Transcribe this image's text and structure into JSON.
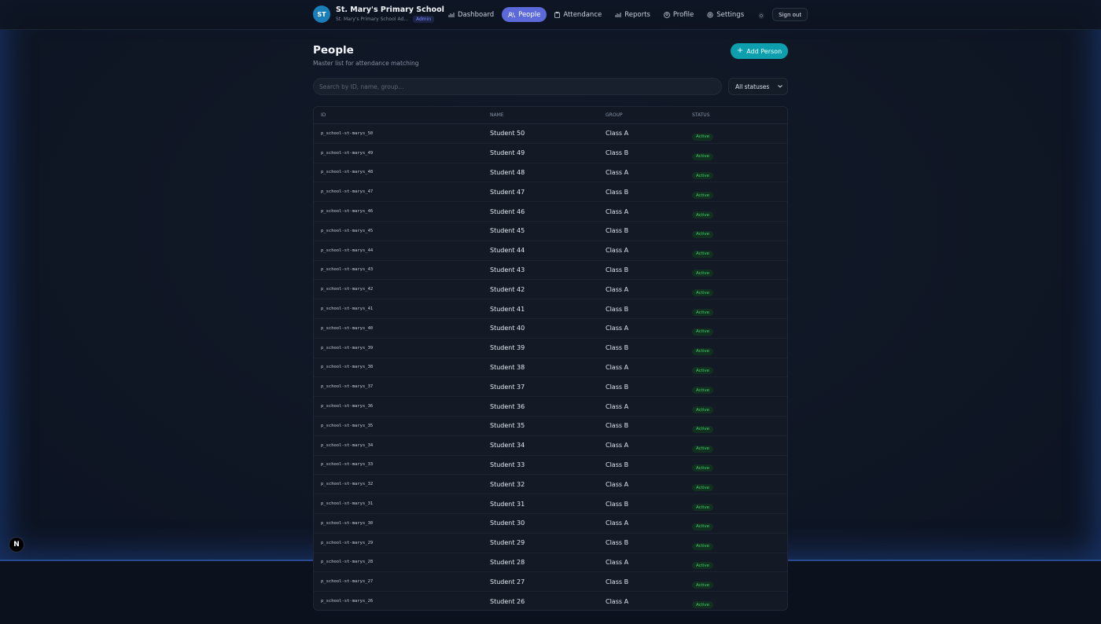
{
  "brand": {
    "initials": "ST",
    "name": "St. Mary's Primary School",
    "subtitle": "St. Mary's Primary School Ad...",
    "role_badge": "Admin"
  },
  "nav": {
    "items": [
      {
        "label": "Dashboard",
        "icon": "bar-chart-icon",
        "active": false
      },
      {
        "label": "People",
        "icon": "users-icon",
        "active": true
      },
      {
        "label": "Attendance",
        "icon": "clipboard-icon",
        "active": false
      },
      {
        "label": "Reports",
        "icon": "bar-chart-icon",
        "active": false
      },
      {
        "label": "Profile",
        "icon": "user-circle-icon",
        "active": false
      },
      {
        "label": "Settings",
        "icon": "gear-icon",
        "active": false
      }
    ],
    "theme_icon": "sun-icon",
    "signout_label": "Sign out"
  },
  "page": {
    "title": "People",
    "subtitle": "Master list for attendance matching",
    "add_button_label": "Add Person"
  },
  "filters": {
    "search_placeholder": "Search by ID, name, group...",
    "search_value": "",
    "status_selected": "All statuses"
  },
  "table": {
    "columns": [
      "ID",
      "NAME",
      "GROUP",
      "STATUS"
    ],
    "rows": [
      {
        "id": "p_school-st-marys_50",
        "name": "Student 50",
        "group": "Class A",
        "status": "Active"
      },
      {
        "id": "p_school-st-marys_49",
        "name": "Student 49",
        "group": "Class B",
        "status": "Active"
      },
      {
        "id": "p_school-st-marys_48",
        "name": "Student 48",
        "group": "Class A",
        "status": "Active"
      },
      {
        "id": "p_school-st-marys_47",
        "name": "Student 47",
        "group": "Class B",
        "status": "Active"
      },
      {
        "id": "p_school-st-marys_46",
        "name": "Student 46",
        "group": "Class A",
        "status": "Active"
      },
      {
        "id": "p_school-st-marys_45",
        "name": "Student 45",
        "group": "Class B",
        "status": "Active"
      },
      {
        "id": "p_school-st-marys_44",
        "name": "Student 44",
        "group": "Class A",
        "status": "Active"
      },
      {
        "id": "p_school-st-marys_43",
        "name": "Student 43",
        "group": "Class B",
        "status": "Active"
      },
      {
        "id": "p_school-st-marys_42",
        "name": "Student 42",
        "group": "Class A",
        "status": "Active"
      },
      {
        "id": "p_school-st-marys_41",
        "name": "Student 41",
        "group": "Class B",
        "status": "Active"
      },
      {
        "id": "p_school-st-marys_40",
        "name": "Student 40",
        "group": "Class A",
        "status": "Active"
      },
      {
        "id": "p_school-st-marys_39",
        "name": "Student 39",
        "group": "Class B",
        "status": "Active"
      },
      {
        "id": "p_school-st-marys_38",
        "name": "Student 38",
        "group": "Class A",
        "status": "Active"
      },
      {
        "id": "p_school-st-marys_37",
        "name": "Student 37",
        "group": "Class B",
        "status": "Active"
      },
      {
        "id": "p_school-st-marys_36",
        "name": "Student 36",
        "group": "Class A",
        "status": "Active"
      },
      {
        "id": "p_school-st-marys_35",
        "name": "Student 35",
        "group": "Class B",
        "status": "Active"
      },
      {
        "id": "p_school-st-marys_34",
        "name": "Student 34",
        "group": "Class A",
        "status": "Active"
      },
      {
        "id": "p_school-st-marys_33",
        "name": "Student 33",
        "group": "Class B",
        "status": "Active"
      },
      {
        "id": "p_school-st-marys_32",
        "name": "Student 32",
        "group": "Class A",
        "status": "Active"
      },
      {
        "id": "p_school-st-marys_31",
        "name": "Student 31",
        "group": "Class B",
        "status": "Active"
      },
      {
        "id": "p_school-st-marys_30",
        "name": "Student 30",
        "group": "Class A",
        "status": "Active"
      },
      {
        "id": "p_school-st-marys_29",
        "name": "Student 29",
        "group": "Class B",
        "status": "Active"
      },
      {
        "id": "p_school-st-marys_28",
        "name": "Student 28",
        "group": "Class A",
        "status": "Active"
      },
      {
        "id": "p_school-st-marys_27",
        "name": "Student 27",
        "group": "Class B",
        "status": "Active"
      },
      {
        "id": "p_school-st-marys_26",
        "name": "Student 26",
        "group": "Class A",
        "status": "Active"
      }
    ]
  },
  "dev_badge": "N",
  "colors": {
    "accent": "#0e9fae",
    "nav_active": "#5b6ad8",
    "status_active": "#3ecf6a",
    "background": "#0d1422"
  }
}
